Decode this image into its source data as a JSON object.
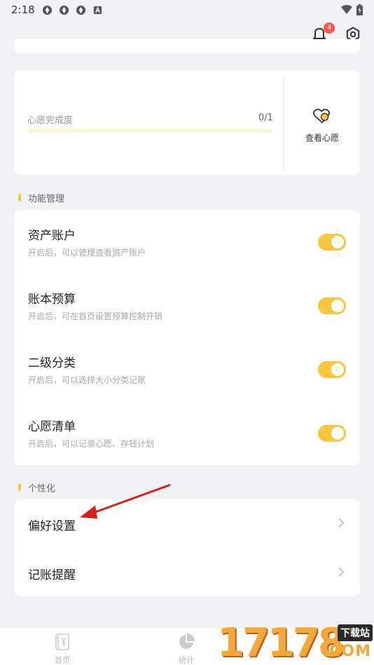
{
  "status_bar": {
    "time": "2:18"
  },
  "header": {
    "notification_count": "4"
  },
  "wish": {
    "progress_label": "心愿完成度",
    "progress_count": "0/1",
    "progress_fraction": 0,
    "view_label": "查看心愿"
  },
  "func_section": {
    "title": "功能管理",
    "items": [
      {
        "title": "资产账户",
        "desc": "开启后，可以管理查看资产账户",
        "enabled": true
      },
      {
        "title": "账本预算",
        "desc": "开启后，可在首页设置预算控制开销",
        "enabled": true
      },
      {
        "title": "二级分类",
        "desc": "开启后，可以选择大小分类记账",
        "enabled": true
      },
      {
        "title": "心愿清单",
        "desc": "开启后，可以记录心愿、存钱计划",
        "enabled": true
      }
    ]
  },
  "personal_section": {
    "title": "个性化",
    "items": [
      {
        "title": "偏好设置"
      },
      {
        "title": "记账提醒"
      }
    ]
  },
  "bottom_nav": {
    "items": [
      {
        "label": "首页",
        "icon": "ledger-icon"
      },
      {
        "label": "统计",
        "icon": "pie-chart-icon"
      }
    ]
  },
  "watermark": {
    "number": "17178",
    "tag": "下载站",
    "suffix": ".COM"
  },
  "colors": {
    "accent": "#f7c83c",
    "background": "#f2f2f5",
    "badge": "#ff5555",
    "arrow": "#d42020"
  }
}
